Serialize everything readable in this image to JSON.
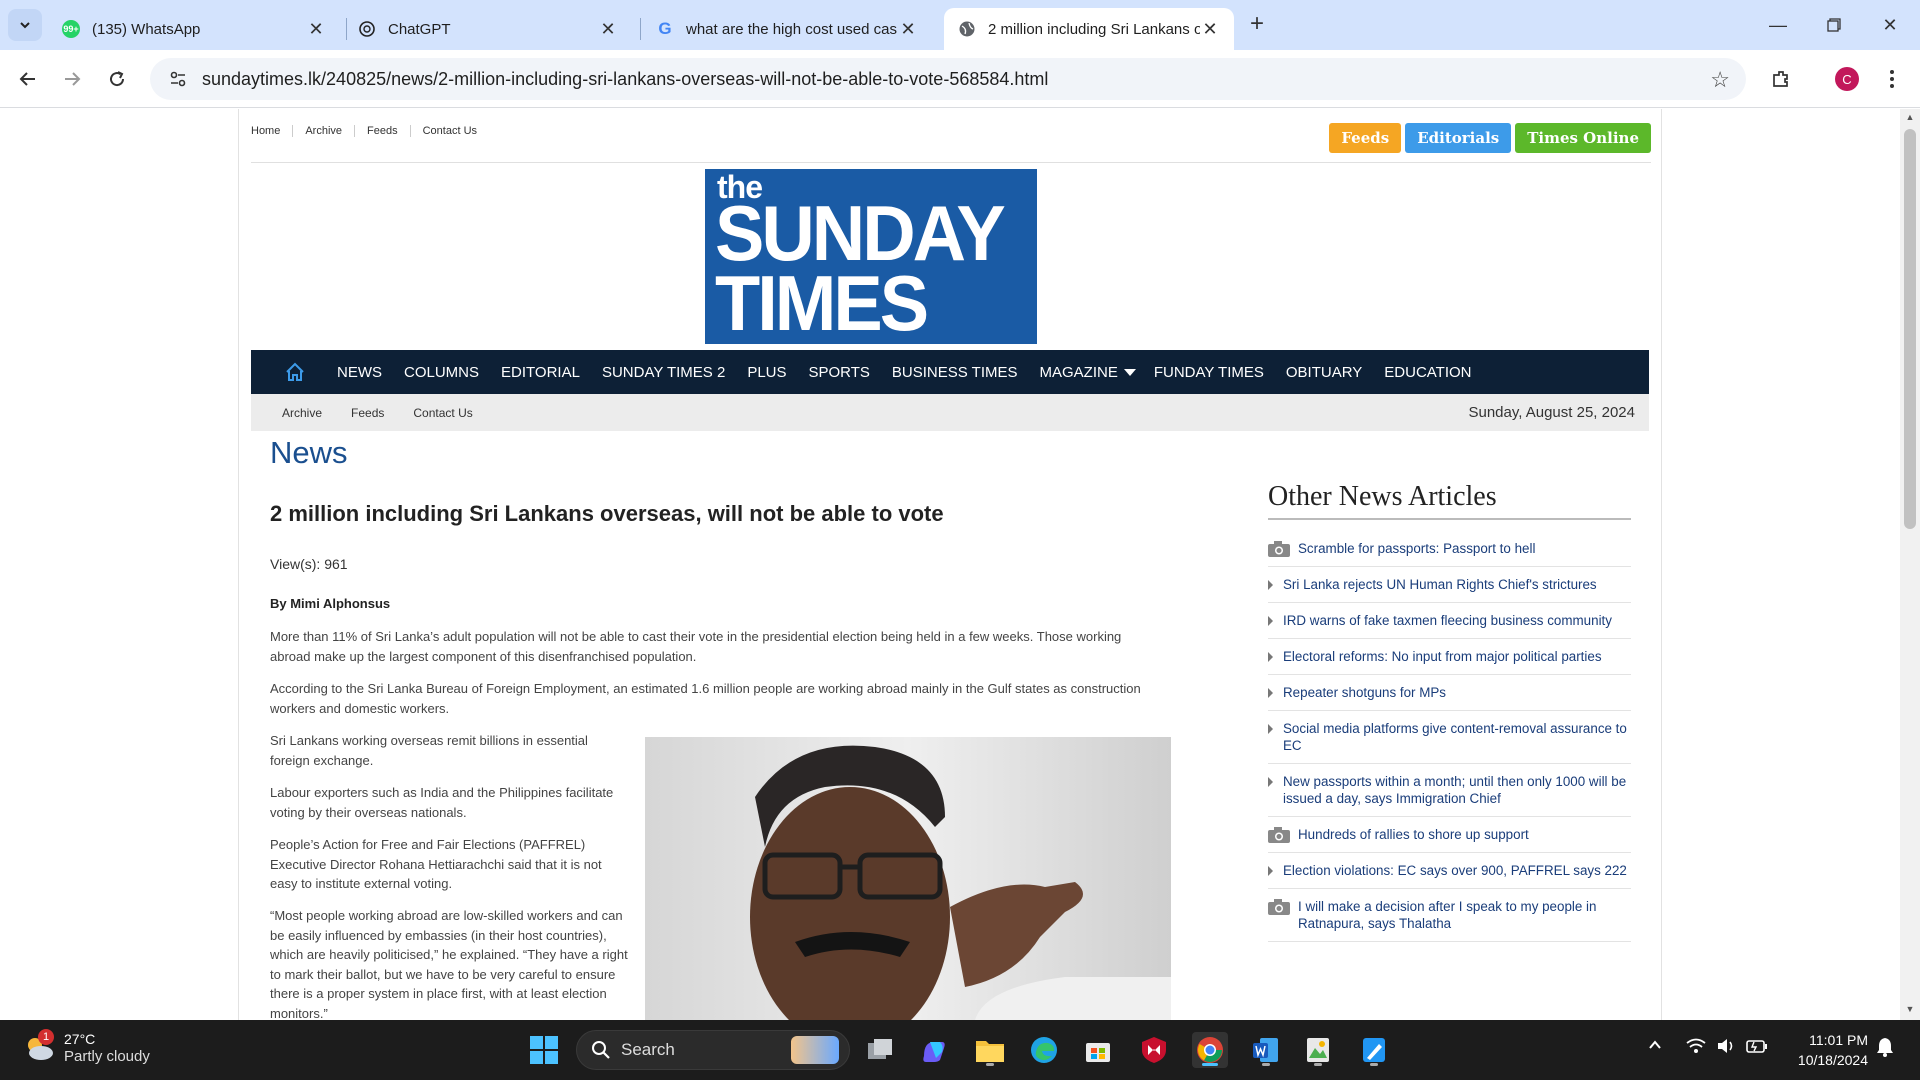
{
  "browser": {
    "tabs": [
      {
        "title": "(135) WhatsApp",
        "favicon": "whatsapp-icon"
      },
      {
        "title": "ChatGPT",
        "favicon": "chatgpt-icon"
      },
      {
        "title": "what are the high cost used cas",
        "favicon": "google-icon"
      },
      {
        "title": "2 million including Sri Lankans o",
        "favicon": "globe-icon",
        "active": true
      }
    ],
    "whatsapp_badge": "99+",
    "url": "sundaytimes.lk/240825/news/2-million-including-sri-lankans-overseas-will-not-be-able-to-vote-568584.html",
    "profile_initial": "C"
  },
  "site": {
    "top_links": [
      "Home",
      "Archive",
      "Feeds",
      "Contact Us"
    ],
    "top_buttons": [
      {
        "label": "Feeds",
        "color": "#f5a623"
      },
      {
        "label": "Editorials",
        "color": "#3d9be9"
      },
      {
        "label": "Times Online",
        "color": "#5cb82a"
      }
    ],
    "logo": {
      "line0": "the",
      "line1": "SUNDAY",
      "line2": "TIMES",
      "bg": "#1a5ba5"
    },
    "main_nav": [
      "NEWS",
      "COLUMNS",
      "EDITORIAL",
      "SUNDAY TIMES 2",
      "PLUS",
      "SPORTS",
      "BUSINESS TIMES",
      "MAGAZINE",
      "FUNDAY TIMES",
      "OBITUARY",
      "EDUCATION"
    ],
    "sub_nav": [
      "Archive",
      "Feeds",
      "Contact Us"
    ],
    "date": "Sunday, August 25, 2024"
  },
  "article": {
    "section": "News",
    "headline": "2 million including Sri Lankans overseas, will not be able to vote",
    "views": "View(s): 961",
    "byline": "By Mimi Alphonsus",
    "paragraphs": [
      "More than 11% of Sri Lanka’s adult population will not be able to cast their vote in the presidential election being held in a few weeks. Those working abroad make up the largest component of this disenfranchised population.",
      "According to the Sri Lanka Bureau of Foreign Employment, an estimated 1.6 million people are working abroad mainly in the Gulf states as construction workers and domestic workers.",
      "Sri Lankans working overseas remit billions in essential foreign exchange.",
      "Labour exporters such as India and the Philippines facilitate voting by their overseas nationals.",
      "People’s Action for Free and Fair Elections (PAFFREL) Executive Director Rohana Hettiarachchi said that it is not easy to institute external voting.",
      "“Most people working abroad are low-skilled workers and can be easily influenced by embassies (in their host countries), which are heavily politicised,” he explained. “They have a right to mark their ballot, but we have to be very careful to ensure there is a proper system in place first, with at least election monitors.”"
    ]
  },
  "sidebar": {
    "title": "Other News Articles",
    "items": [
      {
        "text": "Scramble for passports: Passport to hell",
        "icon": "camera-icon"
      },
      {
        "text": "Sri Lanka rejects UN Human Rights Chief's strictures",
        "icon": "bullet"
      },
      {
        "text": "IRD warns of fake taxmen fleecing business community",
        "icon": "bullet"
      },
      {
        "text": "Electoral reforms: No input from major political parties",
        "icon": "bullet"
      },
      {
        "text": "Repeater shotguns for MPs",
        "icon": "bullet"
      },
      {
        "text": "Social media platforms give content-removal assurance to EC",
        "icon": "bullet"
      },
      {
        "text": "New passports within a month; until then only 1000 will be issued a day, says Immigration Chief",
        "icon": "bullet"
      },
      {
        "text": "Hundreds of rallies to shore up support",
        "icon": "camera-icon"
      },
      {
        "text": "Election violations: EC says over 900, PAFFREL says 222",
        "icon": "bullet"
      },
      {
        "text": "I will make a decision after I speak to my people in Ratnapura, says Thalatha",
        "icon": "camera-icon"
      }
    ]
  },
  "taskbar": {
    "temperature": "27°C",
    "condition": "Partly cloudy",
    "weather_badge": "1",
    "search_label": "Search",
    "time": "11:01 PM",
    "date": "10/18/2024"
  }
}
